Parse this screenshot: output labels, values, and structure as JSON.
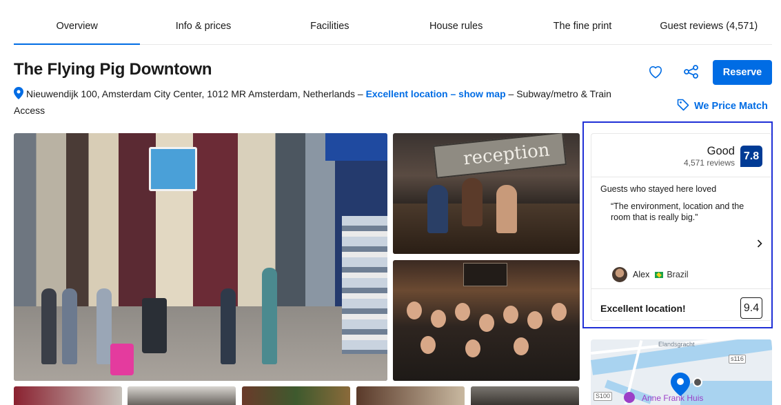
{
  "tabs": [
    {
      "label": "Overview",
      "active": true
    },
    {
      "label": "Info & prices"
    },
    {
      "label": "Facilities"
    },
    {
      "label": "House rules"
    },
    {
      "label": "The fine print"
    },
    {
      "label": "Guest reviews (4,571)"
    }
  ],
  "hotel": {
    "name": "The Flying Pig Downtown",
    "address": "Nieuwendijk 100, Amsterdam City Center, 1012 MR Amsterdam, Netherlands –",
    "location_link": "Excellent location – show map",
    "transport": "– Subway/metro & Train Access"
  },
  "actions": {
    "reserve_label": "Reserve",
    "price_match_label": "We Price Match"
  },
  "review": {
    "score_word": "Good",
    "review_count": "4,571 reviews",
    "score": "7.8",
    "loved_title": "Guests who stayed here loved",
    "quote": "“The environment, location and the room that is really big.”",
    "reviewer_name": "Alex",
    "reviewer_country": "Brazil",
    "location_label": "Excellent location!",
    "location_score": "9.4"
  },
  "photos": {
    "reception_sign": "reception"
  },
  "map": {
    "street": "Elandsgracht",
    "road_1": "s116",
    "road_2": "S100",
    "poi": "Anne Frank Huis"
  },
  "colors": {
    "brand_blue": "#006ce4",
    "score_blue": "#003b95",
    "highlight": "#1f2fd6"
  }
}
